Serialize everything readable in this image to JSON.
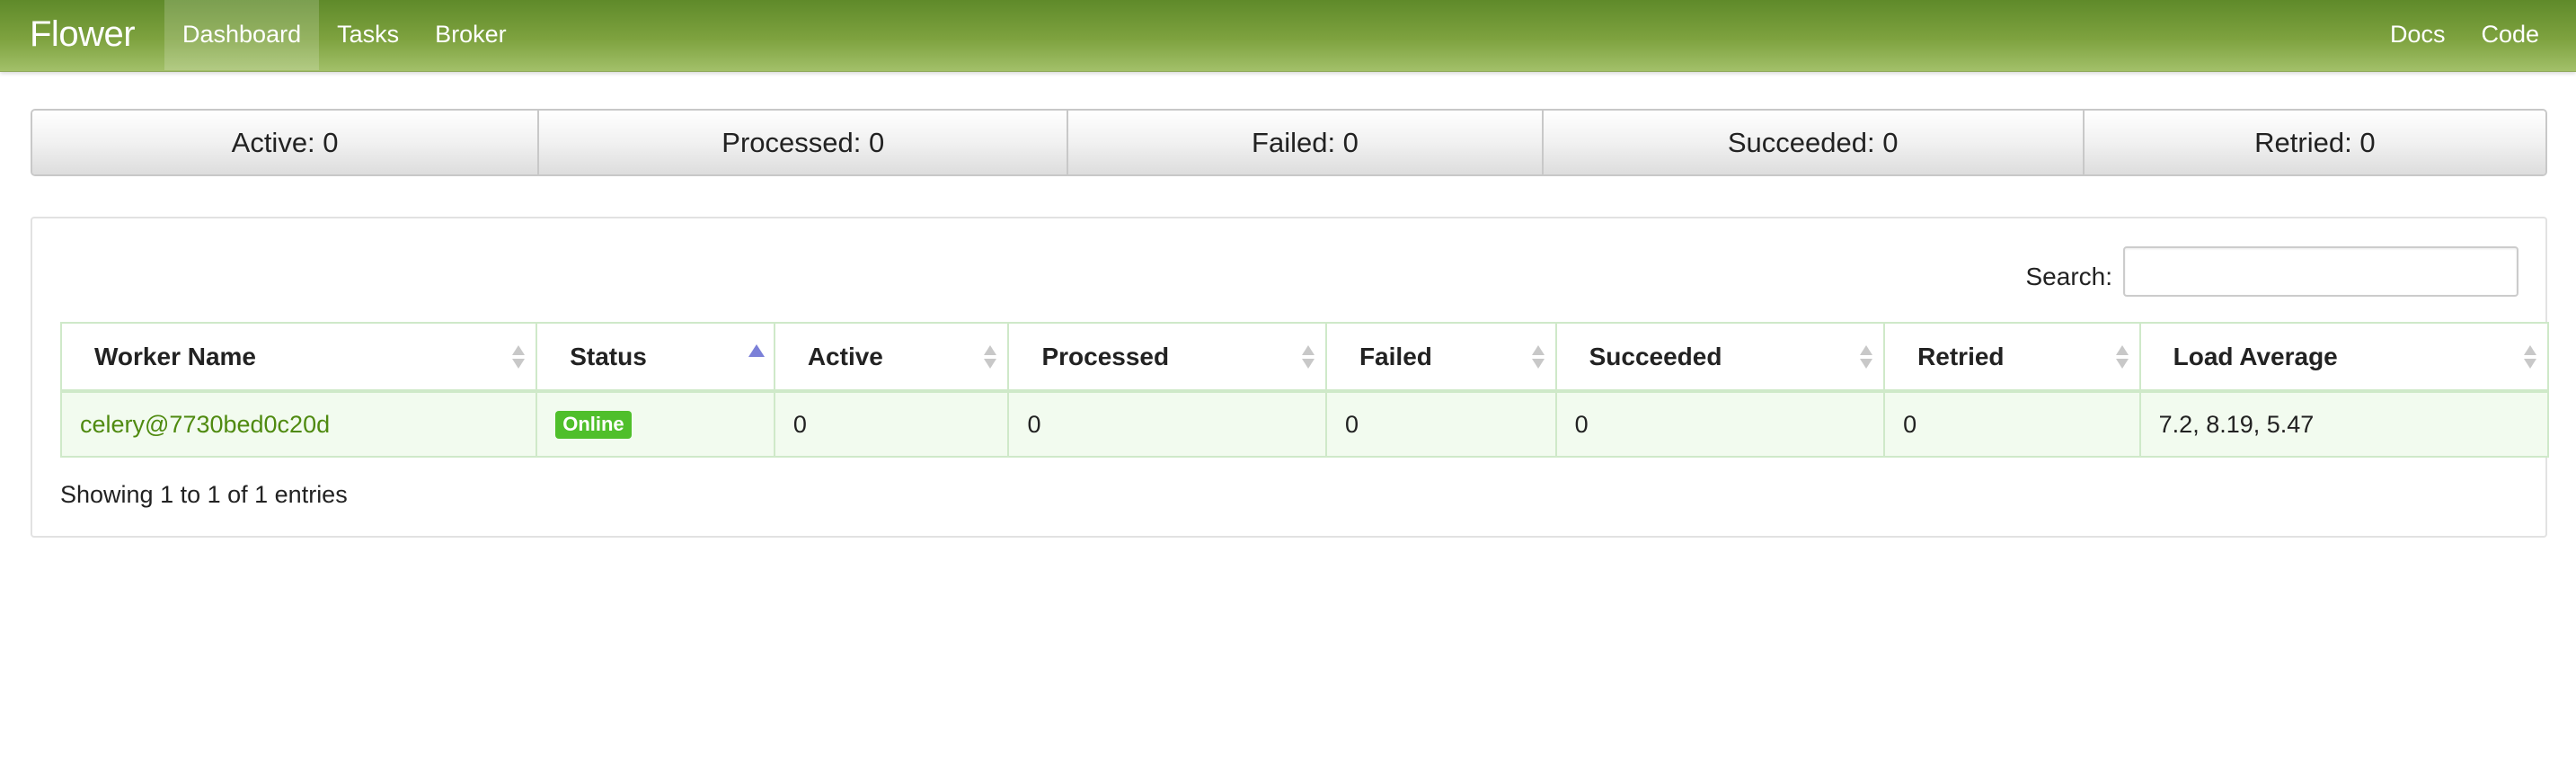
{
  "navbar": {
    "brand": "Flower",
    "left_items": [
      {
        "label": "Dashboard",
        "active": true
      },
      {
        "label": "Tasks",
        "active": false
      },
      {
        "label": "Broker",
        "active": false
      }
    ],
    "right_items": [
      {
        "label": "Docs"
      },
      {
        "label": "Code"
      }
    ]
  },
  "counters": [
    {
      "label": "Active: 0"
    },
    {
      "label": "Processed: 0"
    },
    {
      "label": "Failed: 0"
    },
    {
      "label": "Succeeded: 0"
    },
    {
      "label": "Retried: 0"
    }
  ],
  "workers": {
    "search_label": "Search:",
    "search_value": "",
    "columns": [
      {
        "label": "Worker Name",
        "sort": "none"
      },
      {
        "label": "Status",
        "sort": "asc"
      },
      {
        "label": "Active",
        "sort": "none"
      },
      {
        "label": "Processed",
        "sort": "none"
      },
      {
        "label": "Failed",
        "sort": "none"
      },
      {
        "label": "Succeeded",
        "sort": "none"
      },
      {
        "label": "Retried",
        "sort": "none"
      },
      {
        "label": "Load Average",
        "sort": "none"
      }
    ],
    "rows": [
      {
        "name": "celery@7730bed0c20d",
        "status": "Online",
        "active": "0",
        "processed": "0",
        "failed": "0",
        "succeeded": "0",
        "retried": "0",
        "load_average": "7.2, 8.19, 5.47"
      }
    ],
    "info": "Showing 1 to 1 of 1 entries"
  },
  "colors": {
    "navbar_top": "#5f8a2a",
    "navbar_bottom": "#a2c069",
    "link": "#4f8a10",
    "online_badge": "#4fbf2b",
    "sort_active": "#7b80d8",
    "row_bg": "#f2fbef"
  },
  "icons": {
    "sort_both": "sort-both-icon",
    "sort_asc": "sort-asc-icon"
  }
}
